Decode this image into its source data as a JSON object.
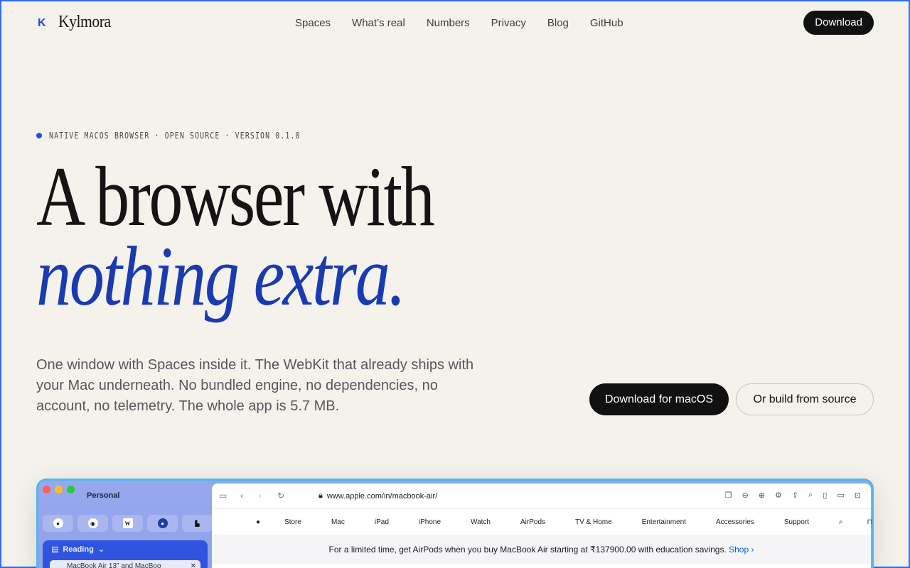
{
  "nav": {
    "brand": "Kylmora",
    "links": [
      "Spaces",
      "What’s real",
      "Numbers",
      "Privacy",
      "Blog",
      "GitHub"
    ],
    "download_label": "Download"
  },
  "hero": {
    "eyebrow": "NATIVE MACOS BROWSER · OPEN SOURCE · VERSION 0.1.0",
    "headline_line1": "A browser with",
    "headline_line2": "nothing extra.",
    "lede": "One window with Spaces inside it. The WebKit that already ships with your Mac underneath. No bundled engine, no dependencies, no account, no telemetry. The whole app is 5.7 MB.",
    "cta_primary": "Download for macOS",
    "cta_secondary": "Or build from source"
  },
  "preview": {
    "sidebar_title": "Personal",
    "favorites": [
      "apple-icon",
      "github-icon",
      "wikipedia-icon",
      "nasa-icon",
      "app-icon"
    ],
    "folder_label": "Reading",
    "folder_item": "MacBook Air 13\" and MacBoo",
    "url": "www.apple.com/in/macbook-air/",
    "apple_nav": [
      "Store",
      "Mac",
      "iPad",
      "iPhone",
      "Watch",
      "AirPods",
      "TV & Home",
      "Entertainment",
      "Accessories",
      "Support"
    ],
    "banner_text": "For a limited time, get AirPods when you buy MacBook Air starting at ₹137900.00 with education savings.",
    "banner_link": "Shop ›",
    "colors": {
      "accent": "#1e4fe0",
      "headline_italic": "#1a3bb0",
      "sidebar": "#8ea8ec"
    }
  }
}
